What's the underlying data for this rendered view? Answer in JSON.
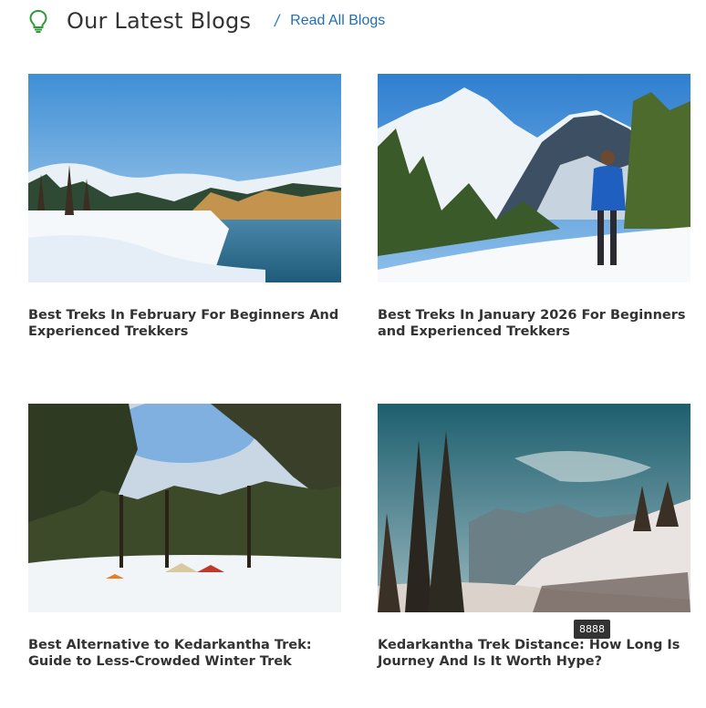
{
  "header": {
    "icon": "lightbulb-icon",
    "title": "Our Latest Blogs",
    "separator": "/",
    "read_all_label": "Read All Blogs",
    "accent_color": "#1f6fb2",
    "icon_color": "#2e9b3a"
  },
  "blogs": [
    {
      "title": "Best Treks In February For Beginners And Experienced Trekkers",
      "image": "snowy lake landscape"
    },
    {
      "title": "Best Treks In January 2026 For Beginners and Experienced Trekkers",
      "image": "trekker in blue jacket on snow"
    },
    {
      "title": "Best Alternative to Kedarkantha Trek: Guide to Less-Crowded Winter Trek",
      "image": "tents in snowy forest camp"
    },
    {
      "title": "Kedarkantha Trek Distance: How Long Is Journey And Is It Worth Hype?",
      "image": "snowy slope with pine trees"
    }
  ],
  "tooltip": "8888"
}
